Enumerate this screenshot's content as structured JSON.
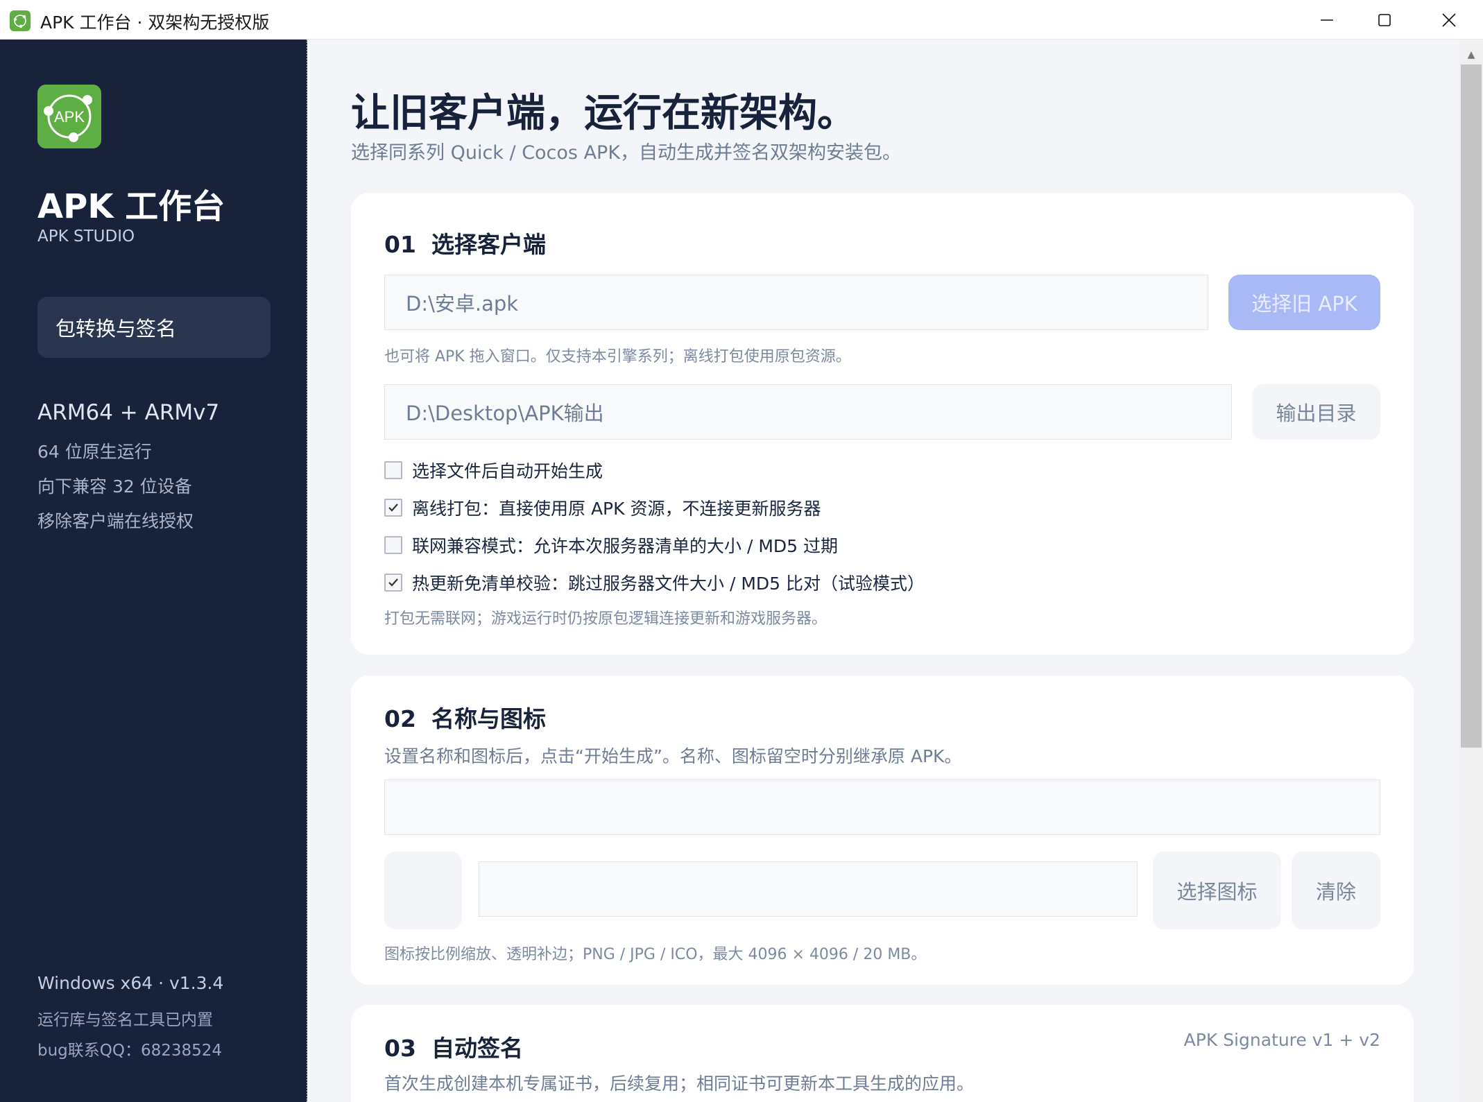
{
  "window": {
    "title": "APK 工作台 · 双架构无授权版",
    "minimize_icon": "minimize-icon",
    "maximize_icon": "maximize-icon",
    "close_icon": "close-icon"
  },
  "sidebar": {
    "brand_title": "APK 工作台",
    "brand_subtitle": "APK STUDIO",
    "logo_text": "APK",
    "nav_active": "包转换与签名",
    "arch_title": "ARM64 + ARMv7",
    "features": [
      "64 位原生运行",
      "向下兼容 32 位设备",
      "移除客户端在线授权"
    ],
    "version": "Windows x64 · v1.3.4",
    "footer_note": "运行库与签名工具已内置",
    "contact": "bug联系QQ：68238524"
  },
  "hero": {
    "title": "让旧客户端，运行在新架构。",
    "subtitle": "选择同系列 Quick / Cocos APK，自动生成并签名双架构安装包。"
  },
  "section1": {
    "num": "01",
    "title": "选择客户端",
    "apk_path": "D:\\安卓.apk",
    "select_apk_label": "选择旧 APK",
    "apk_hint": "也可将 APK 拖入窗口。仅支持本引擎系列；离线打包使用原包资源。",
    "output_path": "D:\\Desktop\\APK输出",
    "output_dir_label": "输出目录",
    "options": [
      {
        "label": "选择文件后自动开始生成",
        "checked": false
      },
      {
        "label": "离线打包：直接使用原 APK 资源，不连接更新服务器",
        "checked": true
      },
      {
        "label": "联网兼容模式：允许本次服务器清单的大小 / MD5 过期",
        "checked": false
      },
      {
        "label": "热更新免清单校验：跳过服务器文件大小 / MD5 比对（试验模式）",
        "checked": true
      }
    ],
    "footer_hint": "打包无需联网；游戏运行时仍按原包逻辑连接更新和游戏服务器。"
  },
  "section2": {
    "num": "02",
    "title": "名称与图标",
    "description": "设置名称和图标后，点击“开始生成”。名称、图标留空时分别继承原 APK。",
    "name_value": "",
    "icon_path_value": "",
    "choose_icon_label": "选择图标",
    "clear_label": "清除",
    "icon_hint": "图标按比例缩放、透明补边；PNG / JPG / ICO，最大 4096 × 4096 / 20 MB。"
  },
  "section3": {
    "num": "03",
    "title": "自动签名",
    "badge": "APK Signature v1 + v2",
    "description": "首次生成创建本机专属证书，后续复用；相同证书可更新本工具生成的应用。"
  },
  "colors": {
    "sidebar_bg": "#19223b",
    "brand_green": "#5fae43",
    "primary_btn": "#a9b9f5",
    "main_bg": "#f3f5f9"
  }
}
